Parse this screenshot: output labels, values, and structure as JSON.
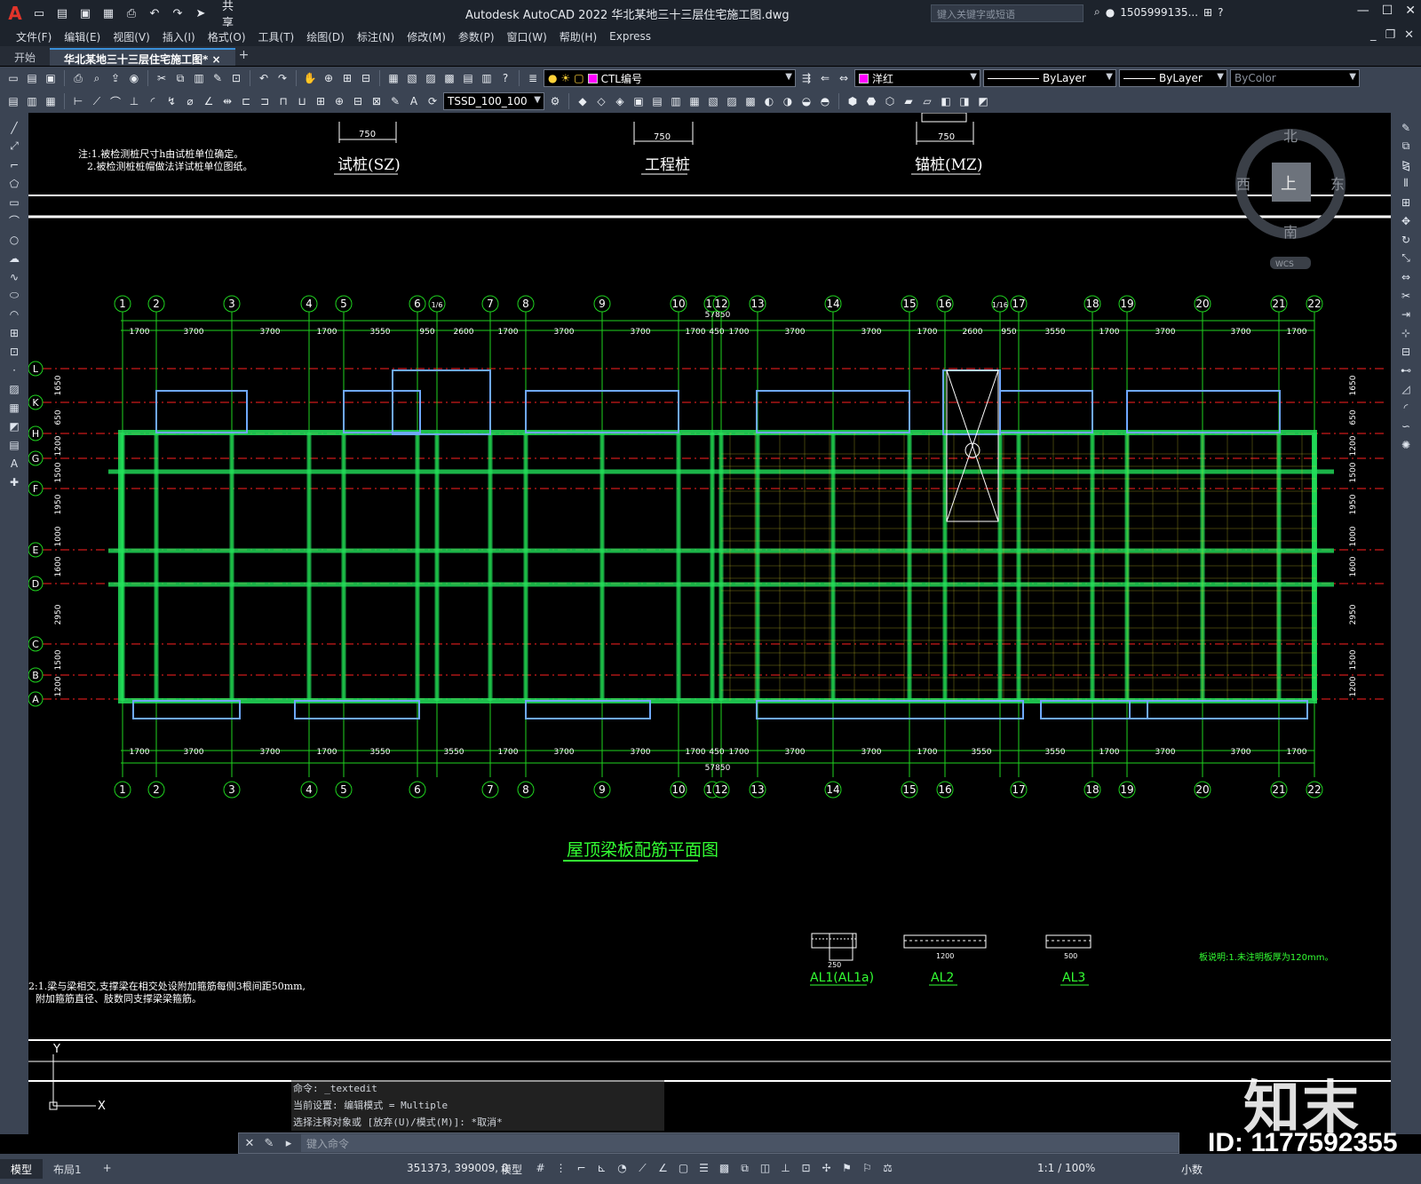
{
  "titlebar": {
    "app_logo": "A",
    "share_label": "共享",
    "title": "Autodesk AutoCAD 2022    华北某地三十三层住宅施工图.dwg",
    "search_placeholder": "键入关键字或短语",
    "user": "1505999135...",
    "quick_access_icons": [
      "new-icon",
      "open-icon",
      "save-icon",
      "saveas-icon",
      "print-icon",
      "undo-icon",
      "redo-icon",
      "share-icon"
    ]
  },
  "menu": [
    "文件(F)",
    "编辑(E)",
    "视图(V)",
    "插入(I)",
    "格式(O)",
    "工具(T)",
    "绘图(D)",
    "标注(N)",
    "修改(M)",
    "参数(P)",
    "窗口(W)",
    "帮助(H)",
    "Express"
  ],
  "tabs": {
    "start": "开始",
    "active": "华北某地三十三层住宅施工图*",
    "close": "×",
    "new": "+"
  },
  "toolbar1": {
    "layer": "CTL编号",
    "color": "洋红",
    "color_hex": "#ff00ff",
    "linetype": "ByLayer",
    "lineweight": "ByLayer",
    "plotstyle": "ByColor"
  },
  "toolbar2": {
    "dimstyle": "TSSD_100_100"
  },
  "drawing": {
    "note_top_1": "注:1.被检测桩尺寸h由试桩单位确定。",
    "note_top_2": "2.被检测桩桩帽做法详试桩单位图纸。",
    "pile_labels": [
      "试桩(SZ)",
      "工程桩",
      "锚桩(MZ)"
    ],
    "pile_dims": [
      "750",
      "750",
      "750"
    ],
    "axis_top": [
      "1",
      "2",
      "3",
      "4",
      "5",
      "6",
      "1/6",
      "7",
      "8",
      "9",
      "10",
      "11",
      "12",
      "13",
      "14",
      "15",
      "16",
      "1/16",
      "17",
      "18",
      "19",
      "20",
      "21",
      "22"
    ],
    "axis_bottom": [
      "1",
      "2",
      "3",
      "4",
      "5",
      "6",
      "7",
      "8",
      "9",
      "10",
      "11",
      "12",
      "13",
      "14",
      "15",
      "16",
      "17",
      "18",
      "19",
      "20",
      "21",
      "22"
    ],
    "axis_rows": [
      "L",
      "K",
      "H",
      "G",
      "F",
      "E",
      "D",
      "C",
      "B",
      "A"
    ],
    "dims_top": [
      "1700",
      "3700",
      "3700",
      "1700",
      "3550",
      "950",
      "2600",
      "1700",
      "3700",
      "3700",
      "1700",
      "450",
      "1700",
      "3700",
      "3700",
      "1700",
      "2600",
      "950",
      "3550",
      "1700",
      "3700",
      "3700",
      "1700"
    ],
    "dims_bottom": [
      "1700",
      "3700",
      "3700",
      "1700",
      "3550",
      "3550",
      "1700",
      "3700",
      "3700",
      "1700",
      "450",
      "1700",
      "3700",
      "3700",
      "1700",
      "3550",
      "3550",
      "1700",
      "3700",
      "3700",
      "1700"
    ],
    "total_dim": "57850",
    "row_dims": [
      "1650",
      "650",
      "1200",
      "1500",
      "1950",
      "1000",
      "1600",
      "2950",
      "1500",
      "1200"
    ],
    "plan_title": "屋顶梁板配筋平面图",
    "sections": [
      "AL1(AL1a)",
      "AL2",
      "AL3"
    ],
    "section_dims": [
      "250",
      "1200",
      "500"
    ],
    "note_bottom_1": "2:1.梁与梁相交,支撑梁在相交处设附加箍筋每侧3根间距50mm,",
    "note_bottom_2": "附加箍筋直径、肢数同支撑梁梁箍筋。",
    "slab_note": "板说明:1.未注明板厚为120mm。",
    "compass": {
      "n": "北",
      "s": "南",
      "e": "东",
      "w": "西",
      "center": "上",
      "wcs": "WCS"
    }
  },
  "command": {
    "history": [
      "命令: _textedit",
      "当前设置: 编辑模式 = Multiple",
      "选择注释对象或 [放弃(U)/模式(M)]: *取消*"
    ],
    "placeholder": "键入命令"
  },
  "status": {
    "tabs": [
      "模型",
      "布局1"
    ],
    "coords": "351373, 399009, 0",
    "mode": "模型",
    "scale": "1:1 / 100%",
    "units": "小数"
  },
  "watermark": {
    "logo": "知末",
    "id": "ID: 1177592355"
  }
}
